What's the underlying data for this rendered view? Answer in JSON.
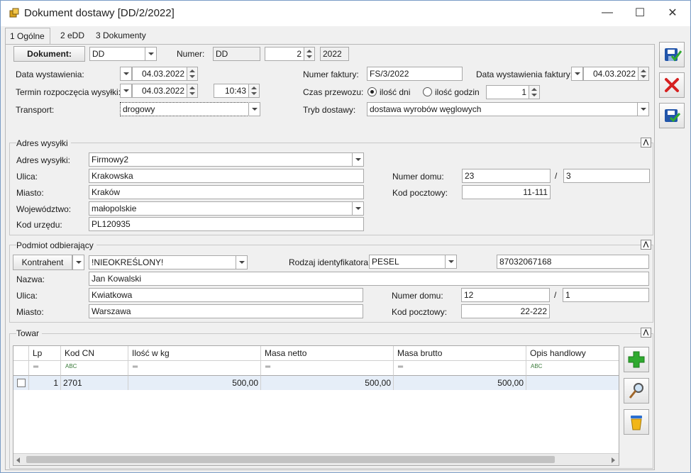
{
  "window": {
    "title": "Dokument dostawy [DD/2/2022]"
  },
  "tabs": [
    {
      "label": "1 Ogólne"
    },
    {
      "label": "2 eDD"
    },
    {
      "label": "3 Dokumenty"
    }
  ],
  "header": {
    "dokument_button": "Dokument:",
    "dokument_type": "DD",
    "numer_label": "Numer:",
    "numer_prefix": "DD",
    "numer_value": "2",
    "numer_year": "2022",
    "data_wyst_label": "Data wystawienia:",
    "data_wyst_value": "04.03.2022",
    "termin_label": "Termin rozpoczęcia wysyłki:",
    "termin_date": "04.03.2022",
    "termin_time": "10:43",
    "transport_label": "Transport:",
    "transport_value": "drogowy",
    "numer_faktury_label": "Numer faktury:",
    "numer_faktury_value": "FS/3/2022",
    "data_faktury_label": "Data wystawienia faktury:",
    "data_faktury_value": "04.03.2022",
    "czas_label": "Czas przewozu:",
    "radio_dni": "ilość dni",
    "radio_godzin": "ilość godzin",
    "czas_value": "1",
    "tryb_label": "Tryb dostawy:",
    "tryb_value": "dostawa wyrobów węglowych"
  },
  "adres": {
    "section_title": "Adres wysyłki",
    "adres_label": "Adres wysyłki:",
    "adres_value": "Firmowy2",
    "ulica_label": "Ulica:",
    "ulica_value": "Krakowska",
    "miasto_label": "Miasto:",
    "miasto_value": "Kraków",
    "woj_label": "Województwo:",
    "woj_value": "małopolskie",
    "urzad_label": "Kod urzędu:",
    "urzad_value": "PL120935",
    "numer_domu_label": "Numer domu:",
    "numer_domu_value": "23",
    "numer_lokalu_value": "3",
    "slash": "/",
    "kod_label": "Kod pocztowy:",
    "kod_value": "11-111"
  },
  "podmiot": {
    "section_title": "Podmiot odbierający",
    "type_button": "Kontrahent",
    "kontrahent_value": "!NIEOKREŚLONY!",
    "rodzaj_label": "Rodzaj identyfikatora:",
    "rodzaj_value": "PESEL",
    "identyfikator_value": "87032067168",
    "nazwa_label": "Nazwa:",
    "nazwa_value": "Jan Kowalski",
    "ulica_label": "Ulica:",
    "ulica_value": "Kwiatkowa",
    "miasto_label": "Miasto:",
    "miasto_value": "Warszawa",
    "numer_domu_label": "Numer domu:",
    "numer_domu_value": "12",
    "numer_lokalu_value": "1",
    "slash": "/",
    "kod_label": "Kod pocztowy:",
    "kod_value": "22-222"
  },
  "towar": {
    "section_title": "Towar",
    "columns": [
      "Lp",
      "Kod CN",
      "Ilość w kg",
      "Masa netto",
      "Masa brutto",
      "Opis handlowy"
    ],
    "filter_eq": "═",
    "filter_abc": "ABC",
    "rows": [
      {
        "lp": "1",
        "kod_cn": "2701",
        "ilosc": "500,00",
        "netto": "500,00",
        "brutto": "500,00",
        "opis": ""
      }
    ]
  },
  "icons": {
    "save": "save-icon",
    "cancel": "close-icon",
    "save_new": "save-new-icon",
    "add": "plus-icon",
    "view": "magnifier-icon",
    "delete": "trash-icon"
  },
  "colors": {
    "accent_green": "#2faa2f",
    "cancel_red": "#d62020",
    "save_blue": "#2255aa",
    "row_selected": "#e6eef8"
  }
}
